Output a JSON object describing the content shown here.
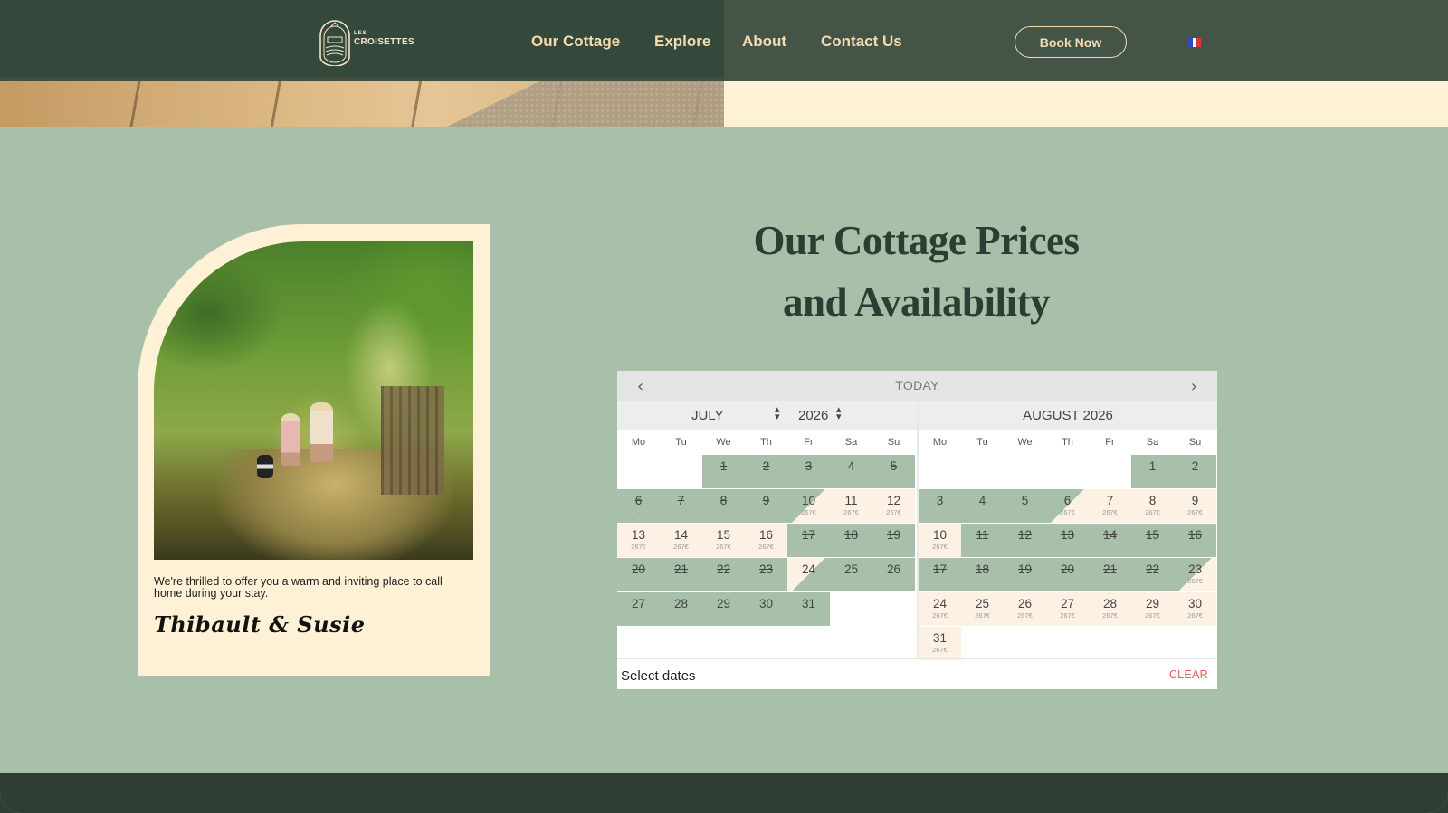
{
  "nav": {
    "logo_small": "LES",
    "logo_big": "CROISETTES",
    "links": [
      "Our Cottage",
      "Explore",
      "About",
      "Contact Us"
    ],
    "book_label": "Book Now",
    "language": "fr-flag-icon"
  },
  "intro": {
    "welcome": "We're thrilled to offer you a warm and inviting place to call home during your stay.",
    "signature": "Thibault & Susie"
  },
  "section": {
    "title_line1": "Our Cottage Prices",
    "title_line2": "and Availability"
  },
  "calendar": {
    "today_label": "TODAY",
    "left_month": "JULY",
    "left_year": "2026",
    "right_title": "AUGUST 2026",
    "weekdays": [
      "Mo",
      "Tu",
      "We",
      "Th",
      "Fr",
      "Sa",
      "Su"
    ],
    "price": "267€",
    "booked_marker": "-",
    "select_label": "Select dates",
    "clear_label": "CLEAR",
    "july": {
      "offset": 2,
      "days": [
        {
          "d": "1",
          "s": "booked"
        },
        {
          "d": "2",
          "s": "booked"
        },
        {
          "d": "3",
          "s": "booked"
        },
        {
          "d": "4",
          "s": "greenfree"
        },
        {
          "d": "5",
          "s": "booked"
        },
        {
          "d": "6",
          "s": "booked"
        },
        {
          "d": "7",
          "s": "booked"
        },
        {
          "d": "8",
          "s": "booked"
        },
        {
          "d": "9",
          "s": "booked"
        },
        {
          "d": "10",
          "s": "out-in"
        },
        {
          "d": "11",
          "s": "avail"
        },
        {
          "d": "12",
          "s": "avail"
        },
        {
          "d": "13",
          "s": "avail"
        },
        {
          "d": "14",
          "s": "avail"
        },
        {
          "d": "15",
          "s": "avail"
        },
        {
          "d": "16",
          "s": "avail"
        },
        {
          "d": "17",
          "s": "booked"
        },
        {
          "d": "18",
          "s": "booked"
        },
        {
          "d": "19",
          "s": "booked"
        },
        {
          "d": "20",
          "s": "booked"
        },
        {
          "d": "21",
          "s": "booked"
        },
        {
          "d": "22",
          "s": "booked"
        },
        {
          "d": "23",
          "s": "booked"
        },
        {
          "d": "24",
          "s": "in-out"
        },
        {
          "d": "25",
          "s": "greenfree"
        },
        {
          "d": "26",
          "s": "greenfree"
        },
        {
          "d": "27",
          "s": "greenfree"
        },
        {
          "d": "28",
          "s": "greenfree"
        },
        {
          "d": "29",
          "s": "greenfree"
        },
        {
          "d": "30",
          "s": "greenfree"
        },
        {
          "d": "31",
          "s": "greenfree"
        }
      ]
    },
    "august": {
      "offset": 5,
      "days": [
        {
          "d": "1",
          "s": "greenfree"
        },
        {
          "d": "2",
          "s": "greenfree"
        },
        {
          "d": "3",
          "s": "greenfree"
        },
        {
          "d": "4",
          "s": "greenfree"
        },
        {
          "d": "5",
          "s": "greenfree"
        },
        {
          "d": "6",
          "s": "out-in"
        },
        {
          "d": "7",
          "s": "avail"
        },
        {
          "d": "8",
          "s": "avail"
        },
        {
          "d": "9",
          "s": "avail"
        },
        {
          "d": "10",
          "s": "avail"
        },
        {
          "d": "11",
          "s": "booked"
        },
        {
          "d": "12",
          "s": "booked"
        },
        {
          "d": "13",
          "s": "booked"
        },
        {
          "d": "14",
          "s": "booked"
        },
        {
          "d": "15",
          "s": "booked"
        },
        {
          "d": "16",
          "s": "booked"
        },
        {
          "d": "17",
          "s": "booked"
        },
        {
          "d": "18",
          "s": "booked"
        },
        {
          "d": "19",
          "s": "booked"
        },
        {
          "d": "20",
          "s": "booked"
        },
        {
          "d": "21",
          "s": "booked"
        },
        {
          "d": "22",
          "s": "booked"
        },
        {
          "d": "23",
          "s": "out-in"
        },
        {
          "d": "24",
          "s": "avail"
        },
        {
          "d": "25",
          "s": "avail"
        },
        {
          "d": "26",
          "s": "avail"
        },
        {
          "d": "27",
          "s": "avail"
        },
        {
          "d": "28",
          "s": "avail"
        },
        {
          "d": "29",
          "s": "avail"
        },
        {
          "d": "30",
          "s": "avail"
        },
        {
          "d": "31",
          "s": "avail"
        }
      ]
    }
  },
  "colors": {
    "nav_bg": "#34483c",
    "page_bg": "#a8c0aa",
    "cream": "#fff1d6",
    "accent_text": "#f3dcae",
    "booked": "#a8c0aa",
    "available": "#fdf1e4",
    "clear": "#e85a5a"
  }
}
